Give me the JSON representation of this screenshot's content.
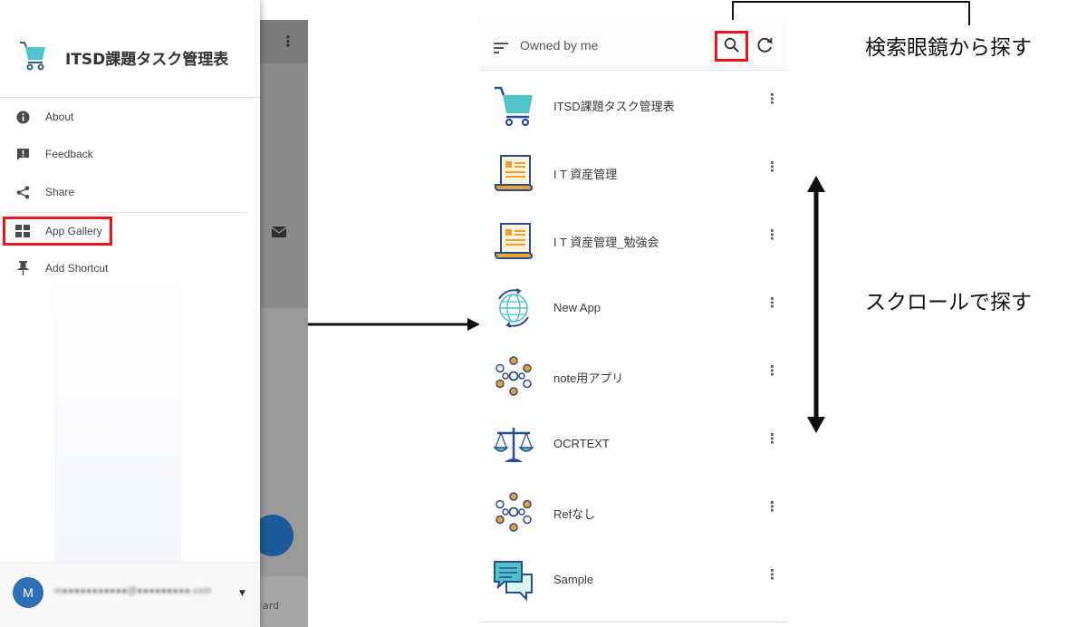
{
  "left_screen": {
    "app_title": "ITSD課題タスク管理表",
    "menu": [
      {
        "label": "About",
        "icon": "info-icon"
      },
      {
        "label": "Feedback",
        "icon": "feedback-icon"
      },
      {
        "label": "Share",
        "icon": "share-icon"
      },
      {
        "label": "App Gallery",
        "icon": "grid-icon"
      },
      {
        "label": "Add Shortcut",
        "icon": "pin-icon"
      }
    ],
    "account": {
      "avatar_initial": "M",
      "email_blurred": "m●●●●●●●●●●●@●●●●●●●●●.com"
    },
    "background_partial_text": "ard"
  },
  "right_screen": {
    "filter_label": "Owned by me",
    "apps": [
      {
        "name": "ITSD課題タスク管理表",
        "icon": "cart-icon"
      },
      {
        "name": "I T 資産管理",
        "icon": "scroll-icon"
      },
      {
        "name": "I T 資産管理_勉強会",
        "icon": "scroll-icon"
      },
      {
        "name": "New App",
        "icon": "globe-icon"
      },
      {
        "name": "note用アプリ",
        "icon": "dots-circle-icon"
      },
      {
        "name": "OCRTEXT",
        "icon": "scales-icon"
      },
      {
        "name": "Refなし",
        "icon": "dots-circle-icon"
      },
      {
        "name": "Sample",
        "icon": "chat-icon"
      }
    ]
  },
  "annotations": {
    "search": "検索眼鏡から探す",
    "scroll": "スクロールで探す"
  },
  "colors": {
    "highlight": "#e8151c",
    "accent_teal": "#4fc3c9",
    "accent_orange": "#f0a030",
    "accent_navy": "#2a4d8f"
  }
}
